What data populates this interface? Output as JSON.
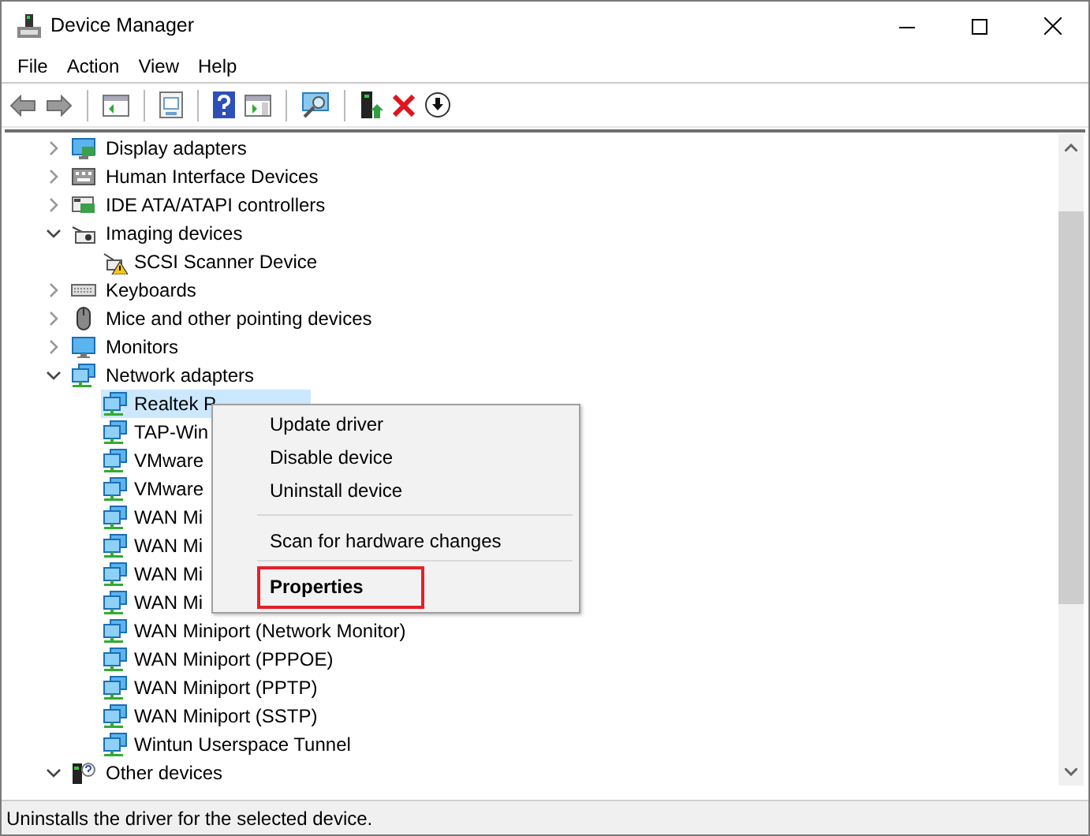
{
  "window": {
    "title": "Device Manager"
  },
  "menu_bar": [
    "File",
    "Action",
    "View",
    "Help"
  ],
  "tree": [
    {
      "label": "Display adapters",
      "expanded": false,
      "selected": false
    },
    {
      "label": "Human Interface Devices",
      "expanded": false,
      "selected": false
    },
    {
      "label": "IDE ATA/ATAPI controllers",
      "expanded": false,
      "selected": false
    },
    {
      "label": "Imaging devices",
      "expanded": true,
      "selected": false,
      "children": [
        {
          "label": "SCSI Scanner Device",
          "selected": false
        }
      ]
    },
    {
      "label": "Keyboards",
      "expanded": false,
      "selected": false
    },
    {
      "label": "Mice and other pointing devices",
      "expanded": false,
      "selected": false
    },
    {
      "label": "Monitors",
      "expanded": false,
      "selected": false
    },
    {
      "label": "Network adapters",
      "expanded": true,
      "selected": false,
      "children": [
        {
          "label": "Realtek P",
          "selected": true
        },
        {
          "label": "TAP-Win",
          "selected": false
        },
        {
          "label": "VMware",
          "selected": false
        },
        {
          "label": "VMware",
          "selected": false
        },
        {
          "label": "WAN Mi",
          "selected": false
        },
        {
          "label": "WAN Mi",
          "selected": false
        },
        {
          "label": "WAN Mi",
          "selected": false
        },
        {
          "label": "WAN Mi",
          "selected": false
        },
        {
          "label": "WAN Miniport (Network Monitor)",
          "selected": false
        },
        {
          "label": "WAN Miniport (PPPOE)",
          "selected": false
        },
        {
          "label": "WAN Miniport (PPTP)",
          "selected": false
        },
        {
          "label": "WAN Miniport (SSTP)",
          "selected": false
        },
        {
          "label": "Wintun Userspace Tunnel",
          "selected": false
        }
      ]
    },
    {
      "label": "Other devices",
      "expanded": true,
      "selected": false
    }
  ],
  "context_menu": [
    {
      "kind": "item",
      "label": "Update driver",
      "default": false,
      "outlined": false
    },
    {
      "kind": "item",
      "label": "Disable device",
      "default": false,
      "outlined": false
    },
    {
      "kind": "item",
      "label": "Uninstall device",
      "default": false,
      "outlined": false
    },
    {
      "kind": "separator"
    },
    {
      "kind": "item",
      "label": "Scan for hardware changes",
      "default": false,
      "outlined": false
    },
    {
      "kind": "separator"
    },
    {
      "kind": "item",
      "label": "Properties",
      "default": true,
      "outlined": true
    }
  ],
  "status_bar": "Uninstalls the driver for the selected device."
}
